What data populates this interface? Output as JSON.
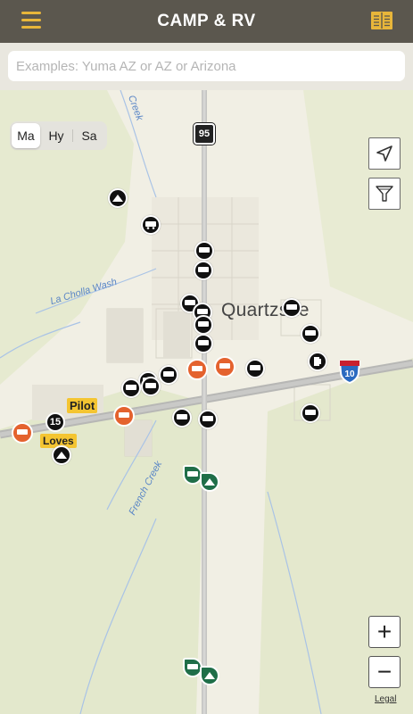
{
  "header": {
    "title": "CAMP & RV",
    "menu_icon": "hamburger-icon",
    "guide_icon": "book-icon",
    "accent": "#e8b63a",
    "bar_color": "#5b574e"
  },
  "search": {
    "placeholder": "Examples: Yuma AZ or AZ or Arizona",
    "value": ""
  },
  "map_type": {
    "options": [
      "Ma",
      "Hy",
      "Sa"
    ],
    "selected": "Ma"
  },
  "map": {
    "town": "Quartzsite",
    "water_labels": {
      "creek_north": "Creek",
      "la_cholla": "La Cholla Wash",
      "french_creek": "French Creek"
    },
    "highway_95": "95",
    "interstate_10": "10",
    "route_15": "15",
    "brands": {
      "pilot": "Pilot",
      "loves": "Loves"
    },
    "legend_colors": {
      "campground": "#111111",
      "rv_park": "#e4622e",
      "public_camp": "#1f6e48"
    }
  },
  "controls": {
    "zoom_in": "+",
    "zoom_out": "−",
    "legal": "Legal",
    "locate_icon": "location-arrow-icon",
    "filter_icon": "funnel-filter-icon"
  }
}
